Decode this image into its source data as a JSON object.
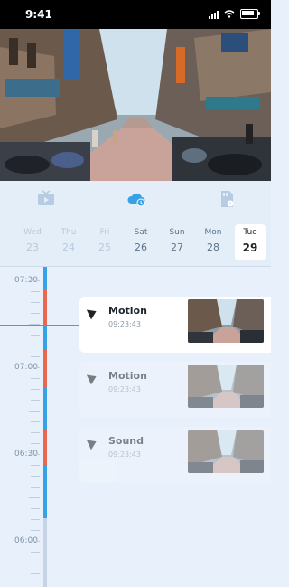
{
  "status": {
    "time": "9:41"
  },
  "tabs": [
    {
      "name": "tv",
      "icon": "tv-icon",
      "color": "#b7cbe2"
    },
    {
      "name": "cloud",
      "icon": "cloud-clock-icon",
      "color": "#37a3e6"
    },
    {
      "name": "sd",
      "icon": "sd-card-icon",
      "color": "#b7cbe2"
    }
  ],
  "dates": [
    {
      "day": "Wed",
      "num": "23"
    },
    {
      "day": "Thu",
      "num": "24"
    },
    {
      "day": "Fri",
      "num": "25"
    },
    {
      "day": "Sat",
      "num": "26"
    },
    {
      "day": "Sun",
      "num": "27"
    },
    {
      "day": "Mon",
      "num": "28"
    },
    {
      "day": "Tue",
      "num": "29"
    }
  ],
  "timeline": {
    "labels": [
      "07:30",
      "07:00",
      "06:30",
      "06:00"
    ]
  },
  "events": [
    {
      "title": "Motion",
      "time": "09:23:43"
    },
    {
      "title": "Motion",
      "time": "09:23:43"
    },
    {
      "title": "Sound",
      "time": "09:23:43"
    }
  ],
  "colors": {
    "accent": "#37a3e6",
    "alert": "#e7684f"
  }
}
